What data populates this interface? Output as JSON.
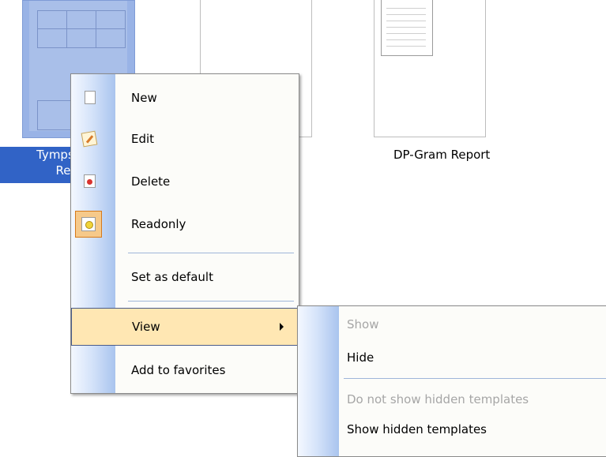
{
  "templates": [
    {
      "name_line1": "Tymps ar",
      "name_line2": "Re",
      "selected": true
    },
    {
      "name_line1": "",
      "name_line2": "",
      "selected": false
    },
    {
      "name_line1": "DP-Gram Report",
      "name_line2": "",
      "selected": false
    }
  ],
  "context_menu": {
    "items": [
      {
        "label": "New",
        "icon": "new-document-icon"
      },
      {
        "label": "Edit",
        "icon": "edit-pencil-icon"
      },
      {
        "label": "Delete",
        "icon": "delete-document-icon"
      },
      {
        "label": "Readonly",
        "icon": "readonly-lock-icon",
        "checked": true
      },
      {
        "label": "Set as default"
      },
      {
        "label": "View",
        "submenu": true,
        "highlighted": true
      },
      {
        "label": "Add to favorites"
      }
    ]
  },
  "view_submenu": {
    "items": [
      {
        "label": "Show",
        "enabled": false
      },
      {
        "label": "Hide",
        "enabled": true
      },
      {
        "label": "Do not show hidden templates",
        "enabled": false
      },
      {
        "label": "Show hidden templates",
        "enabled": true
      }
    ]
  },
  "colors": {
    "selection_blue": "#3163c6",
    "menu_highlight": "#ffe7b3",
    "gutter_blue": "#a9c4ee",
    "disabled_text": "#a6a6a6"
  }
}
